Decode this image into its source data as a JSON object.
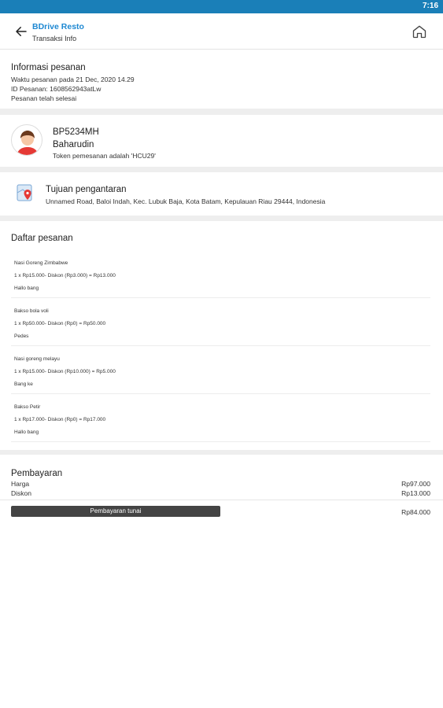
{
  "status_bar": {
    "time": "7:16"
  },
  "app_bar": {
    "title": "BDrive Resto",
    "subtitle": "Transaksi Info"
  },
  "order_info": {
    "heading": "Informasi pesanan",
    "time_line": "Waktu pesanan pada 21 Dec, 2020 14.29",
    "id_line": "ID Pesanan: 1608562943atLw",
    "status_line": "Pesanan telah selesai"
  },
  "driver": {
    "plate": "BP5234MH",
    "name": "Baharudin",
    "token_line": "Token pemesanan adalah 'HCU29'"
  },
  "destination": {
    "heading": "Tujuan pengantaran",
    "address": "Unnamed Road, Baloi Indah, Kec. Lubuk Baja, Kota Batam, Kepulauan Riau 29444, Indonesia"
  },
  "order_list": {
    "heading": "Daftar pesanan",
    "items": [
      {
        "name": "Nasi Goreng Zimbabwe",
        "detail": "1 x Rp15.000- Diskon (Rp3.000) = Rp13.000",
        "note": "Hallo bang"
      },
      {
        "name": "Bakso bola voli",
        "detail": "1 x Rp50.000- Diskon (Rp0) = Rp50.000",
        "note": "Pedes"
      },
      {
        "name": "Nasi goreng melayu",
        "detail": "1 x Rp15.000- Diskon (Rp10.000) = Rp5.000",
        "note": "Bang ke"
      },
      {
        "name": "Bakso Petir",
        "detail": "1 x Rp17.000- Diskon (Rp0) = Rp17.000",
        "note": "Hallo bang"
      }
    ]
  },
  "payment": {
    "heading": "Pembayaran",
    "price_label": "Harga",
    "price_value": "Rp97.000",
    "discount_label": "Diskon",
    "discount_value": "Rp13.000",
    "method_label": "Pembayaran tunai",
    "total_value": "Rp84.000"
  },
  "icons": {
    "back": "arrow-left-icon",
    "home": "home-icon",
    "avatar": "driver-avatar",
    "map": "map-pin-icon"
  },
  "colors": {
    "status_bar": "#1a7fb8",
    "accent": "#1e88d2"
  }
}
